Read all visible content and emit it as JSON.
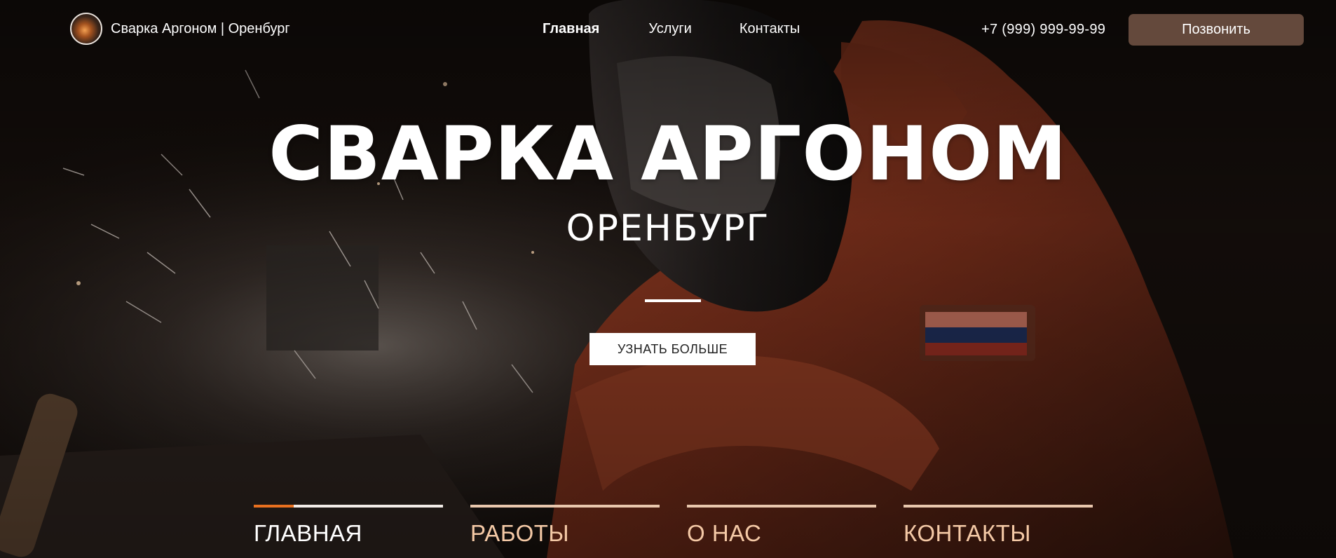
{
  "header": {
    "logo_text": "Сварка Аргоном | Оренбург",
    "nav": [
      "Главная",
      "Услуги",
      "Контакты"
    ],
    "phone": "+7 (999) 999-99-99",
    "call_button": "Позвонить"
  },
  "hero": {
    "title": "СВАРКА АРГОНОМ",
    "subtitle": "ОРЕНБУРГ",
    "more_button": "УЗНАТЬ БОЛЬШЕ"
  },
  "sections": [
    "ГЛАВНАЯ",
    "РАБОТЫ",
    "О НАС",
    "КОНТАКТЫ"
  ],
  "colors": {
    "accent": "#e8701f",
    "section_label": "#f4c9a6",
    "call_button_bg": "#785848"
  }
}
